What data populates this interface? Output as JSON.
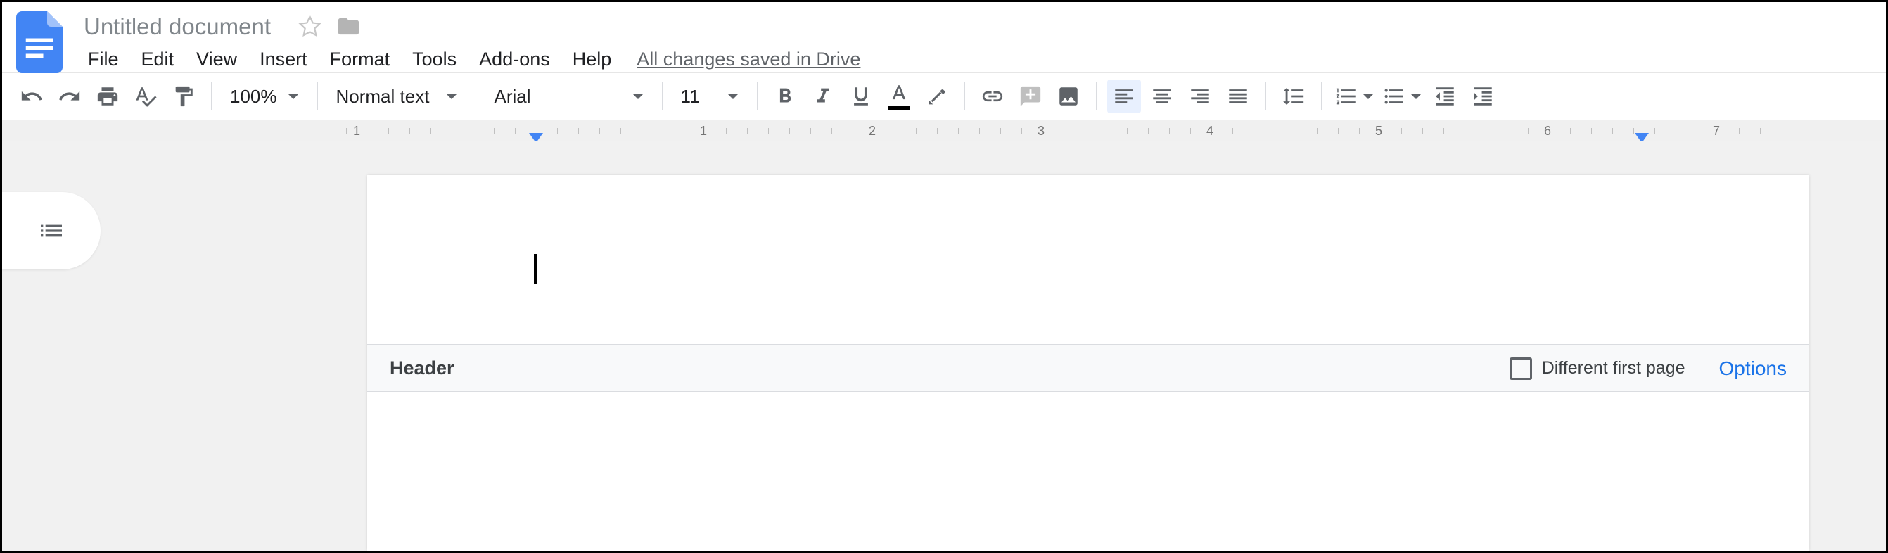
{
  "document": {
    "title": "Untitled document",
    "save_status": "All changes saved in Drive"
  },
  "menubar": {
    "items": [
      "File",
      "Edit",
      "View",
      "Insert",
      "Format",
      "Tools",
      "Add-ons",
      "Help"
    ]
  },
  "toolbar": {
    "zoom": "100%",
    "style": "Normal text",
    "font": "Arial",
    "font_size": "11"
  },
  "ruler": {
    "labels": [
      "1",
      "1",
      "2",
      "3",
      "4",
      "5",
      "6",
      "7"
    ]
  },
  "header": {
    "label": "Header",
    "checkbox_label": "Different first page",
    "options_label": "Options"
  }
}
